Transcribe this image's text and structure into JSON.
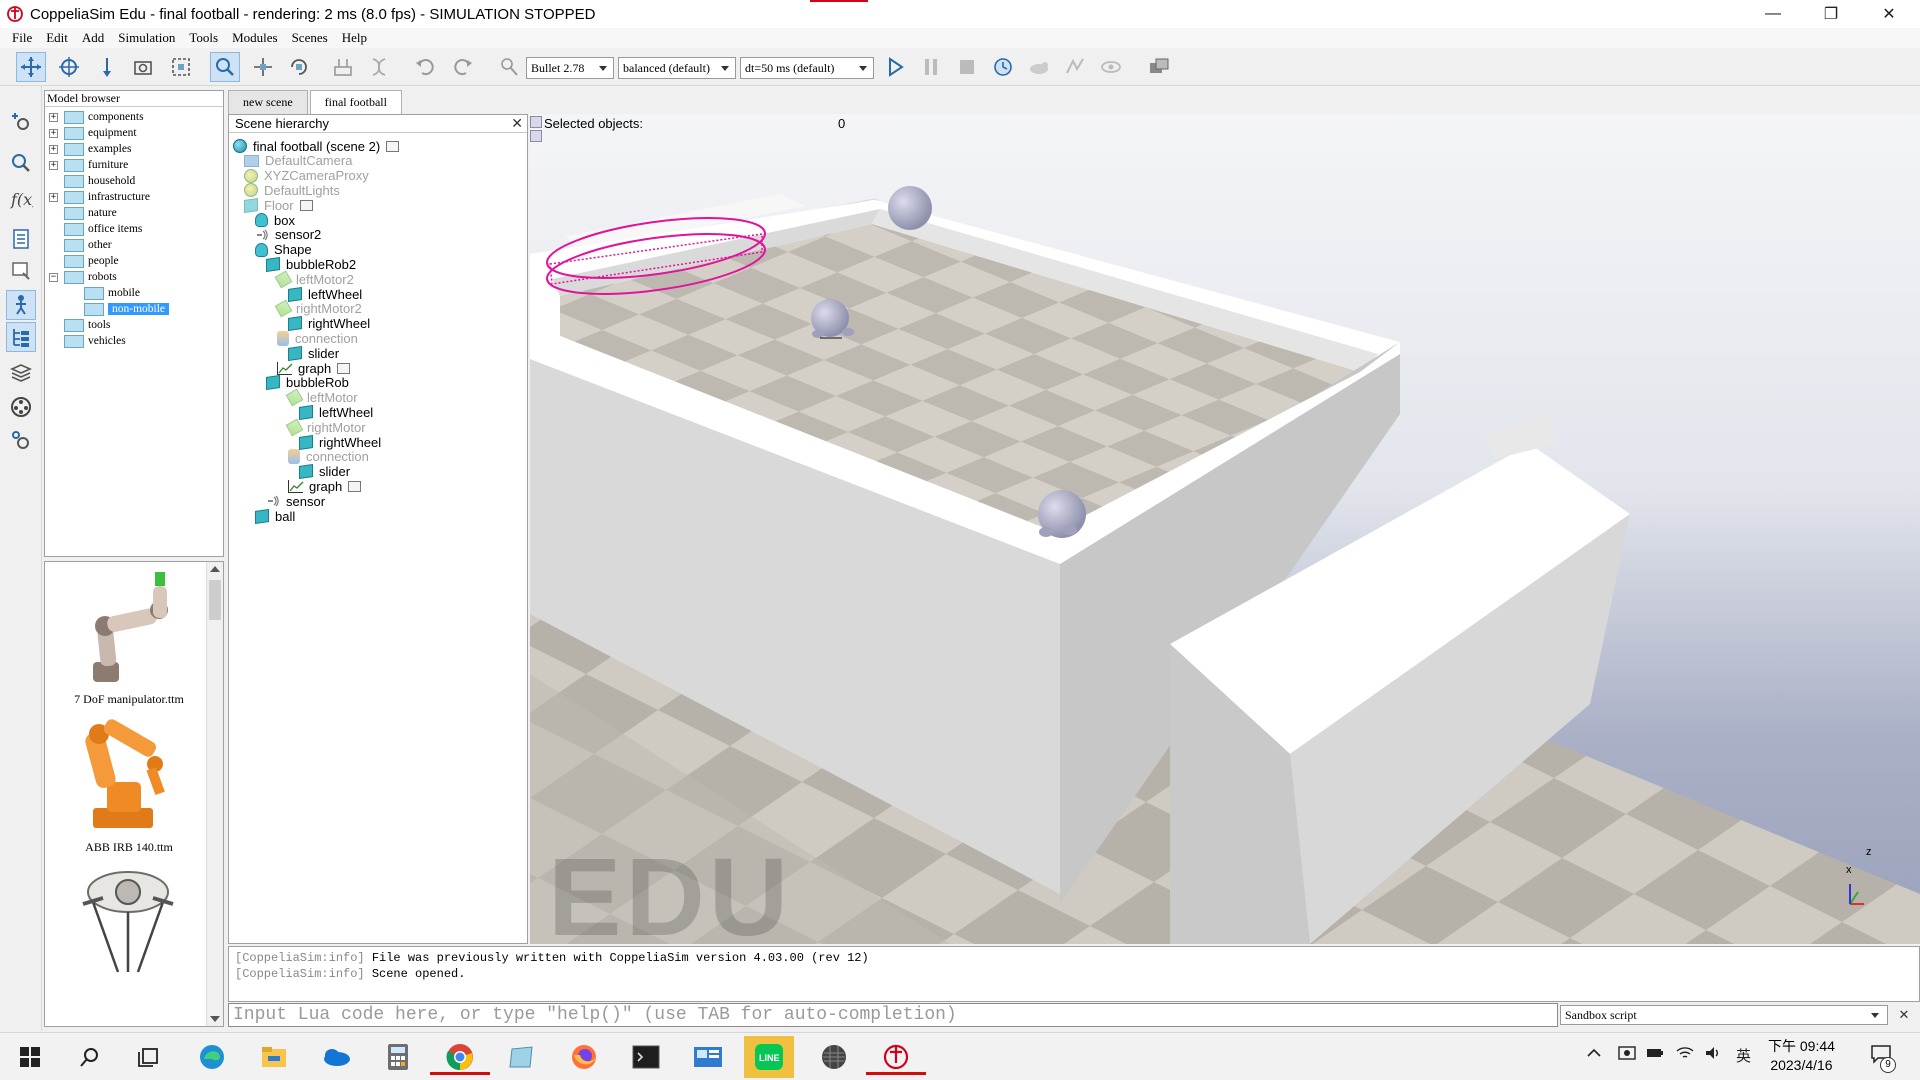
{
  "window": {
    "title": "CoppeliaSim Edu - final football - rendering: 2 ms (8.0 fps) - SIMULATION STOPPED",
    "minimize": "—",
    "maximize": "❐",
    "close": "✕"
  },
  "menu": [
    "File",
    "Edit",
    "Add",
    "Simulation",
    "Tools",
    "Modules",
    "Scenes",
    "Help"
  ],
  "toolbar": {
    "engine": "Bullet 2.78",
    "accuracy": "balanced (default)",
    "timestep": "dt=50 ms (default)"
  },
  "model_browser": {
    "header": "Model browser",
    "items": [
      {
        "label": "components",
        "expandable": true
      },
      {
        "label": "equipment",
        "expandable": true
      },
      {
        "label": "examples",
        "expandable": true
      },
      {
        "label": "furniture",
        "expandable": true
      },
      {
        "label": "household",
        "expandable": false
      },
      {
        "label": "infrastructure",
        "expandable": true
      },
      {
        "label": "nature",
        "expandable": false
      },
      {
        "label": "office items",
        "expandable": false
      },
      {
        "label": "other",
        "expandable": false
      },
      {
        "label": "people",
        "expandable": false
      },
      {
        "label": "robots",
        "expandable": true,
        "expanded": true
      },
      {
        "label": "mobile",
        "expandable": false,
        "indent": 1
      },
      {
        "label": "non-mobile",
        "expandable": false,
        "indent": 1,
        "selected": true
      },
      {
        "label": "tools",
        "expandable": false
      },
      {
        "label": "vehicles",
        "expandable": false
      }
    ]
  },
  "thumbnails": [
    {
      "label": "7 DoF manipulator.ttm"
    },
    {
      "label": "ABB IRB 140.ttm"
    },
    {
      "label": ""
    }
  ],
  "tabs": [
    "new scene",
    "final football"
  ],
  "hierarchy": {
    "header": "Scene hierarchy",
    "close": "✕",
    "rows": [
      {
        "label": "final football (scene 2)",
        "icon": "globe",
        "depth": 0,
        "dim": false
      },
      {
        "label": "DefaultCamera",
        "icon": "camera",
        "depth": 1,
        "dim": true
      },
      {
        "label": "XYZCameraProxy",
        "icon": "light",
        "depth": 1,
        "dim": true
      },
      {
        "label": "DefaultLights",
        "icon": "light",
        "depth": 1,
        "dim": true
      },
      {
        "label": "Floor",
        "icon": "cube",
        "depth": 1,
        "dim": true
      },
      {
        "label": "box",
        "icon": "dummy",
        "depth": 2,
        "dim": false
      },
      {
        "label": "sensor2",
        "icon": "sensor",
        "depth": 2,
        "dim": false
      },
      {
        "label": "Shape",
        "icon": "dummy",
        "depth": 2,
        "dim": false
      },
      {
        "label": "bubbleRob2",
        "icon": "cube",
        "depth": 3,
        "dim": false
      },
      {
        "label": "leftMotor2",
        "icon": "motor",
        "depth": 4,
        "dim": true
      },
      {
        "label": "leftWheel",
        "icon": "cube",
        "depth": 5,
        "dim": false
      },
      {
        "label": "rightMotor2",
        "icon": "motor",
        "depth": 4,
        "dim": true
      },
      {
        "label": "rightWheel",
        "icon": "cube",
        "depth": 5,
        "dim": false
      },
      {
        "label": "connection",
        "icon": "joint",
        "depth": 4,
        "dim": true
      },
      {
        "label": "slider",
        "icon": "cube",
        "depth": 5,
        "dim": false
      },
      {
        "label": "graph",
        "icon": "graph",
        "depth": 4,
        "dim": false
      },
      {
        "label": "bubbleRob",
        "icon": "cube",
        "depth": 3,
        "dim": false
      },
      {
        "label": "leftMotor",
        "icon": "motor",
        "depth": 5,
        "dim": true
      },
      {
        "label": "leftWheel",
        "icon": "cube",
        "depth": 6,
        "dim": false
      },
      {
        "label": "rightMotor",
        "icon": "motor",
        "depth": 5,
        "dim": true
      },
      {
        "label": "rightWheel",
        "icon": "cube",
        "depth": 6,
        "dim": false
      },
      {
        "label": "connection",
        "icon": "joint",
        "depth": 5,
        "dim": true
      },
      {
        "label": "slider",
        "icon": "cube",
        "depth": 6,
        "dim": false
      },
      {
        "label": "graph",
        "icon": "graph",
        "depth": 5,
        "dim": false
      },
      {
        "label": "sensor",
        "icon": "sensor",
        "depth": 3,
        "dim": false
      },
      {
        "label": "ball",
        "icon": "cube",
        "depth": 2,
        "dim": false
      }
    ]
  },
  "viewport": {
    "selected_label": "Selected objects:",
    "selected_count": "0",
    "watermark": "EDU",
    "axis_x": "x",
    "axis_z": "z"
  },
  "console": {
    "lines": [
      {
        "tag": "[CoppeliaSim:info]",
        "text": " File was previously written with CoppeliaSim version 4.03.00 (rev 12)"
      },
      {
        "tag": "[CoppeliaSim:info]",
        "text": " Scene opened."
      }
    ],
    "input_placeholder": "Input Lua code here, or type \"help()\" (use TAB for auto-completion)",
    "script_select": "Sandbox script",
    "close": "✕"
  },
  "taskbar": {
    "time_period": "下午 09:44",
    "date": "2023/4/16",
    "ime": "英",
    "notif_count": "9"
  },
  "colors": {
    "accent": "#3399ff",
    "cube": "#37b7c4",
    "viewport_sky": "#e2e5ec",
    "magenta_sensor": "#e0139b"
  }
}
